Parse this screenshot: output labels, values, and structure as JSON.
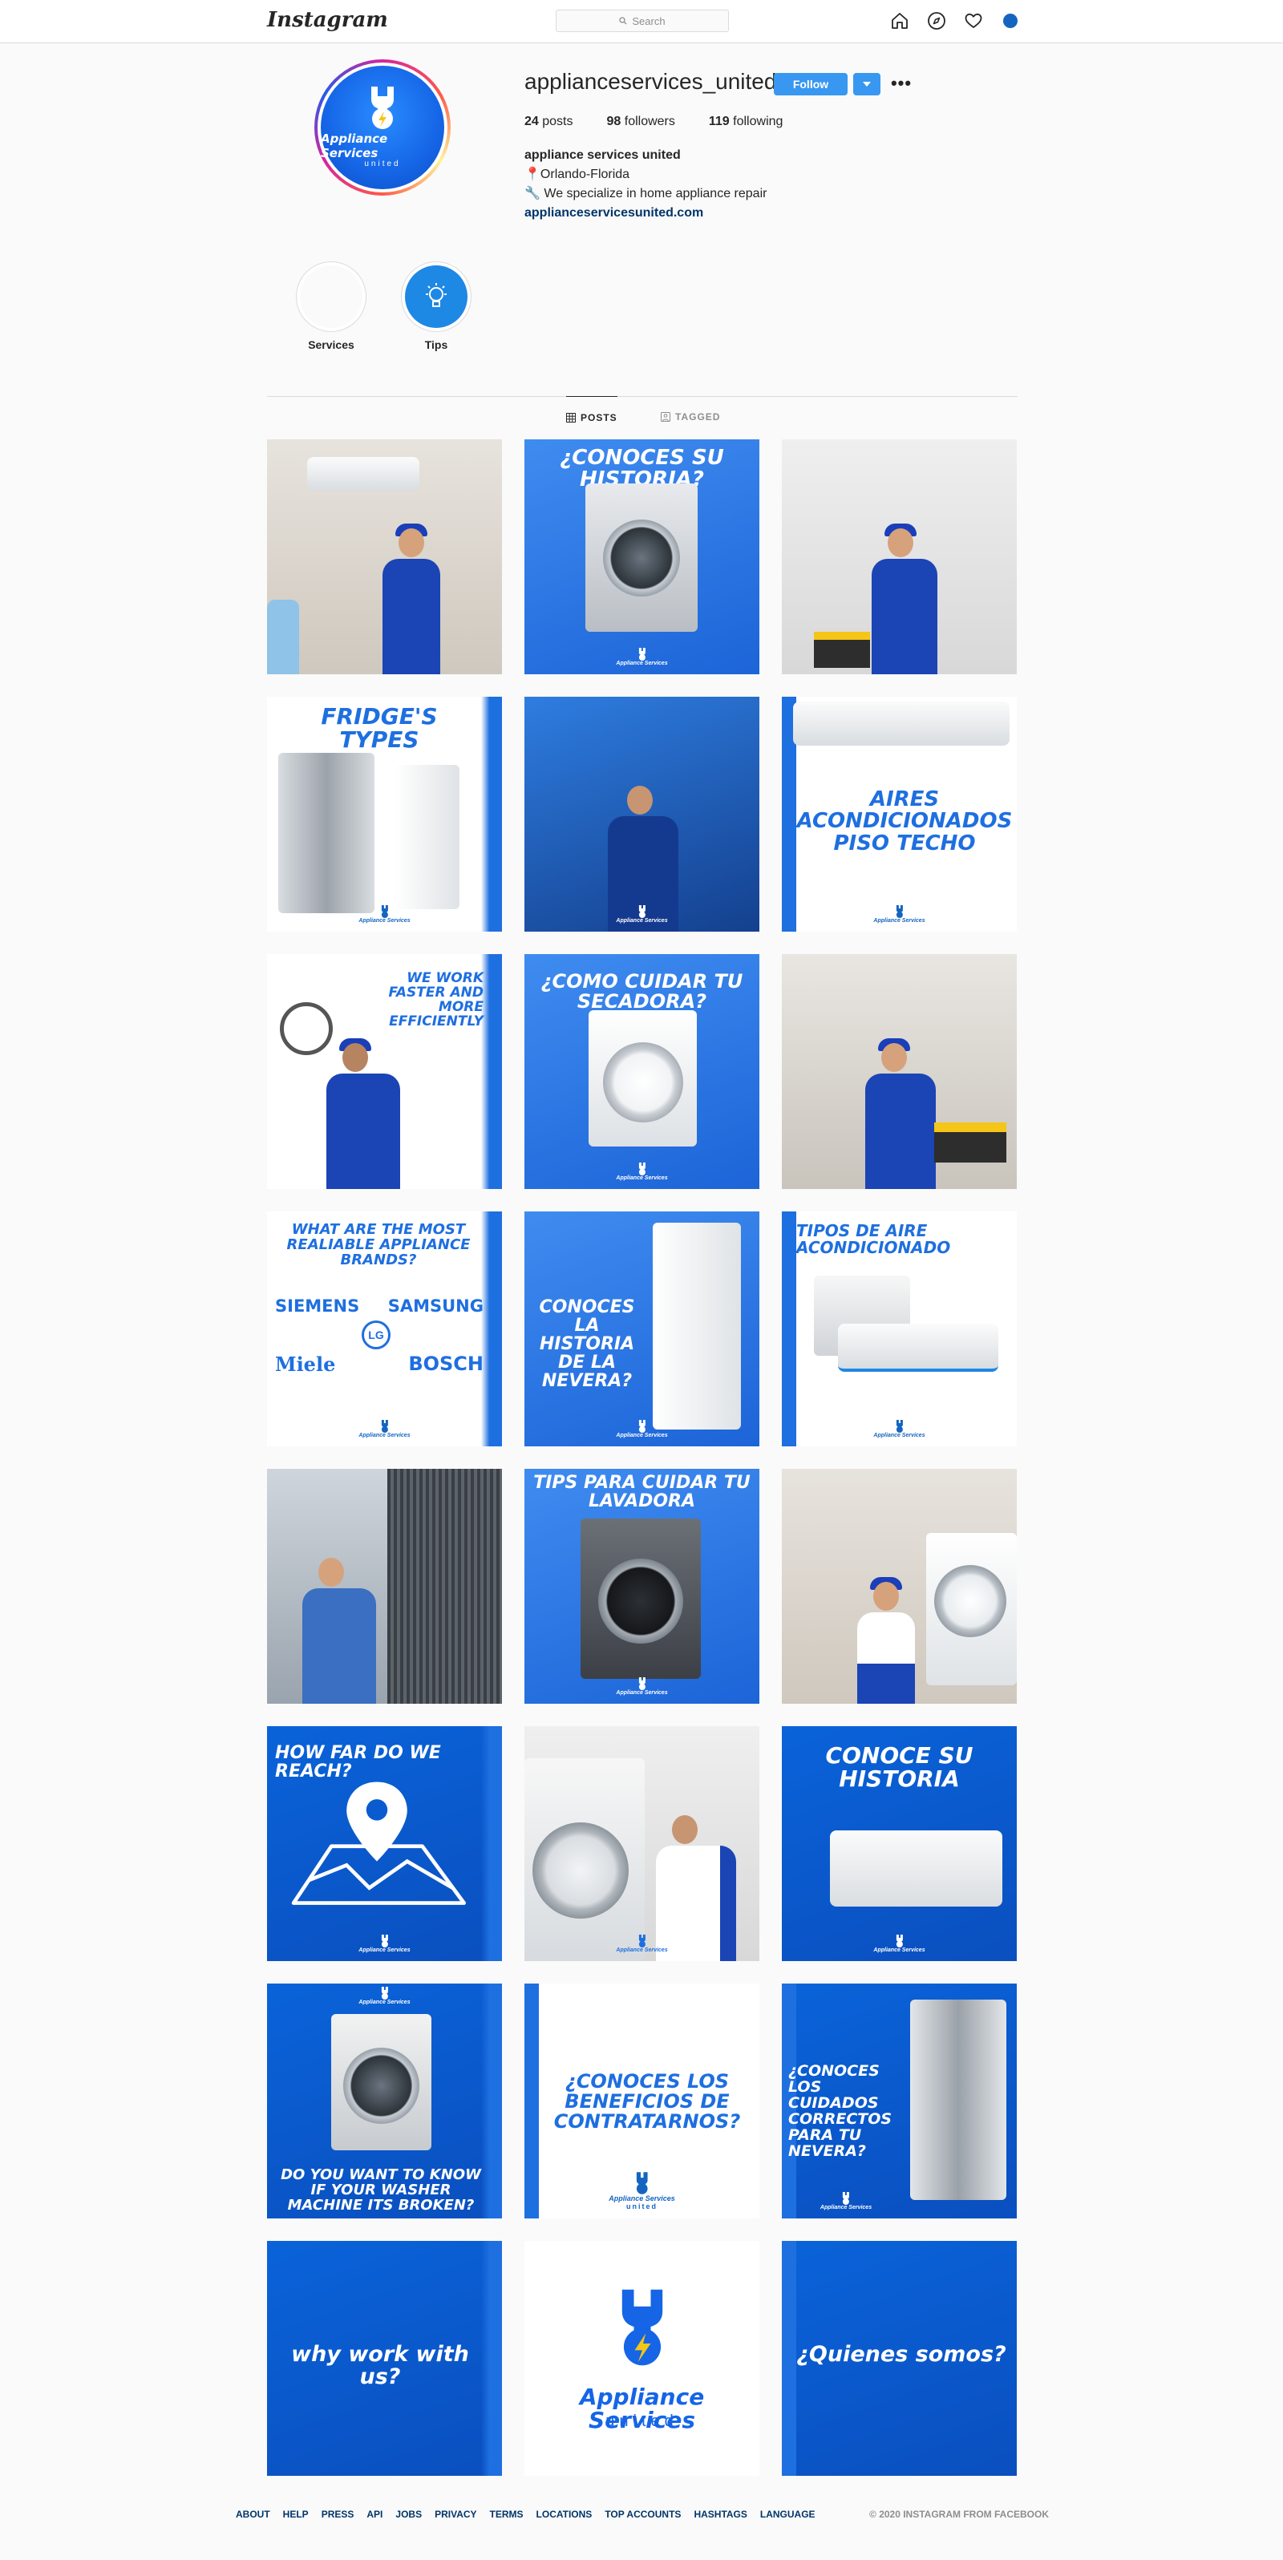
{
  "nav": {
    "logo": "Instagram",
    "search_placeholder": "Search",
    "icons": [
      "home-icon",
      "explore-icon",
      "heart-icon",
      "profile-avatar"
    ]
  },
  "profile": {
    "username": "applianceservices_united",
    "follow_label": "Follow",
    "more_label": "•••",
    "stats": {
      "posts_count": "24",
      "posts_label": "posts",
      "followers_count": "98",
      "followers_label": "followers",
      "following_count": "119",
      "following_label": "following"
    },
    "full_name": "appliance services united",
    "location": "Orlando-Florida",
    "location_icon": "📍",
    "tagline": "We specialize in home appliance repair",
    "tagline_icon": "🔧",
    "website": "applianceservicesunited.com",
    "avatar_brand": "Appliance Services",
    "avatar_sub": "united"
  },
  "highlights": [
    {
      "label": "Services"
    },
    {
      "label": "Tips"
    }
  ],
  "tabs": [
    {
      "label": "POSTS",
      "active": true
    },
    {
      "label": "TAGGED",
      "active": false
    }
  ],
  "posts": {
    "p2": "¿CONOCES SU HISTORIA?",
    "p4": "FRIDGE'S TYPES",
    "p6": "AIRES ACONDICIONADOS PISO TECHO",
    "p7": "WE WORK FASTER AND MORE EFFICIENTLY",
    "p8": "¿COMO CUIDAR TU SECADORA?",
    "p10": "WHAT ARE THE MOST REALIABLE APPLIANCE BRANDS?",
    "p10_brand_a": "SIEMENS",
    "p10_brand_b": "SAMSUNG",
    "p10_brand_c": "LG",
    "p10_brand_d": "Miele",
    "p10_brand_e": "BOSCH",
    "p11": "CONOCES LA HISTORIA DE LA NEVERA?",
    "p12": "TIPOS DE AIRE ACONDICIONADO",
    "p14": "TIPS PARA CUIDAR TU LAVADORA",
    "p16": "HOW FAR  DO WE REACH?",
    "p18": "CONOCE SU HISTORIA",
    "p19": "DO YOU WANT TO KNOW IF YOUR WASHER MACHINE ITS BROKEN?",
    "p20": "¿CONOCES LOS BENEFICIOS DE CONTRATARNOS?",
    "p21": "¿CONOCES LOS CUIDADOS CORRECTOS PARA TU NEVERA?",
    "p22": "why work with us?",
    "p23_brand": "Appliance Services",
    "p23_sub": "united",
    "p24": "¿Quienes somos?",
    "mini_brand": "Appliance Services",
    "mini_sub": "united"
  },
  "footer": {
    "links": [
      "ABOUT",
      "HELP",
      "PRESS",
      "API",
      "JOBS",
      "PRIVACY",
      "TERMS",
      "LOCATIONS",
      "TOP ACCOUNTS",
      "HASHTAGS",
      "LANGUAGE"
    ],
    "copyright": "© 2020 INSTAGRAM FROM FACEBOOK"
  },
  "colors": {
    "brand_blue": "#1e6fe0",
    "follow_blue": "#3897f0",
    "link": "#003569"
  }
}
